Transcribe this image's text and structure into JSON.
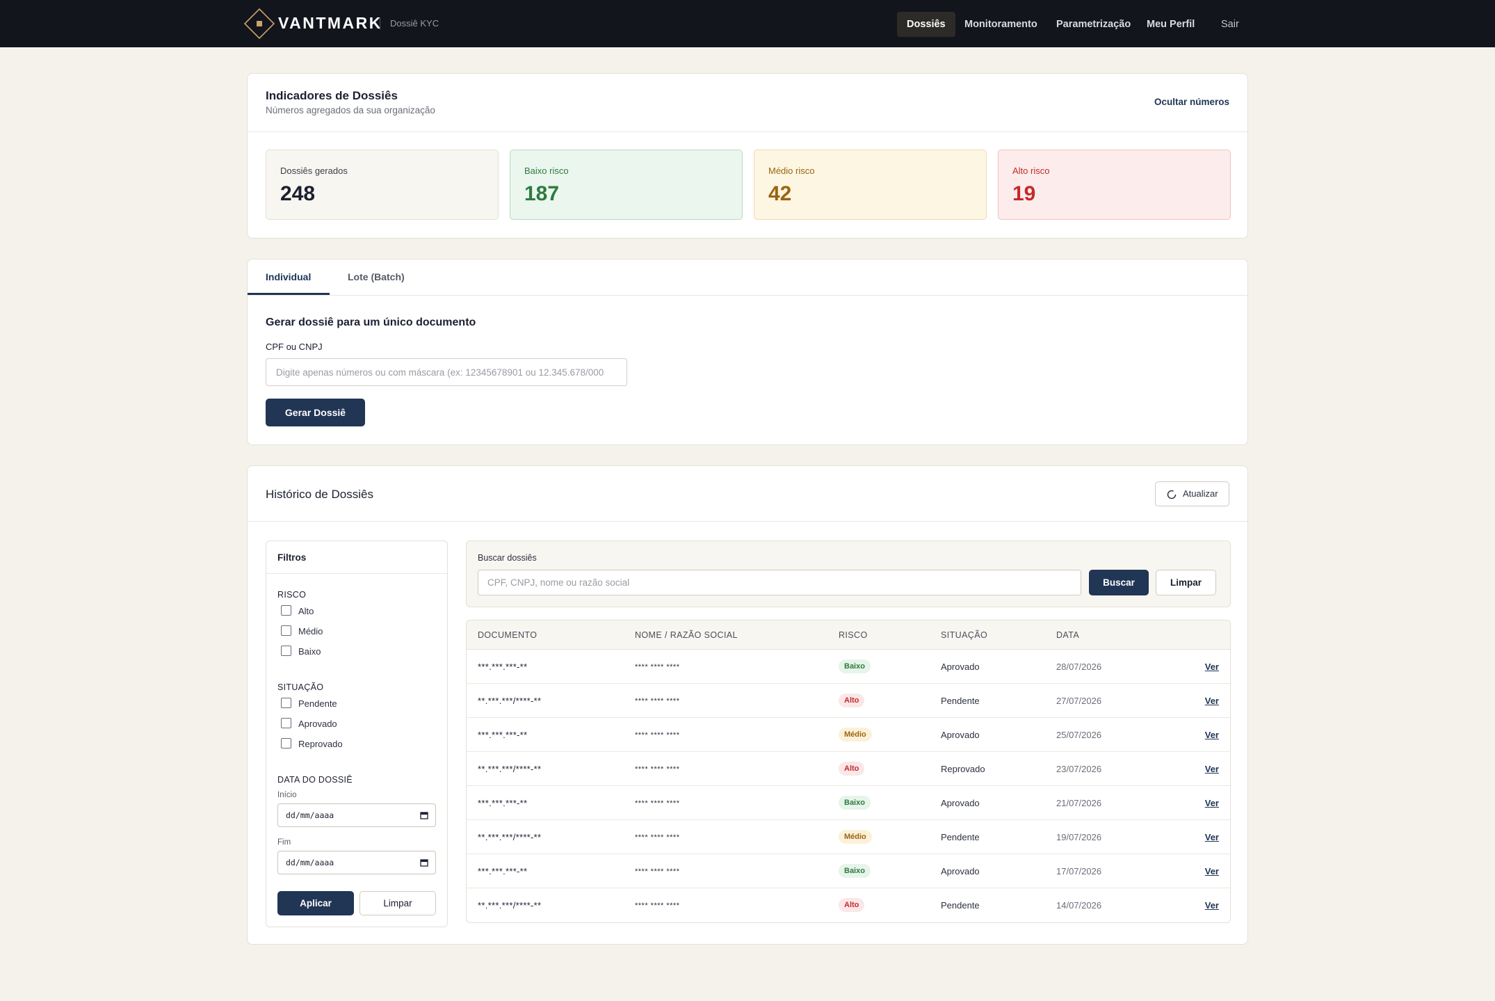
{
  "nav": {
    "brand": "VANTMARK",
    "subtitle": "Dossiê KYC",
    "items": [
      "Dossiês",
      "Monitoramento",
      "Parametrização",
      "Meu Perfil"
    ],
    "logout": "Sair"
  },
  "indicators": {
    "title": "Indicadores de Dossiês",
    "subtitle": "Números agregados da sua organização",
    "hide_label": "Ocultar números",
    "stats": [
      {
        "label": "Dossiês gerados",
        "value": "248",
        "color": "#1c2030"
      },
      {
        "label": "Baixo risco",
        "value": "187",
        "color": "#2f7a3f"
      },
      {
        "label": "Médio risco",
        "value": "42",
        "color": "#9a6510"
      },
      {
        "label": "Alto risco",
        "value": "19",
        "color": "#c42a2a"
      }
    ]
  },
  "generate": {
    "tabs": [
      "Individual",
      "Lote (Batch)"
    ],
    "title": "Gerar dossiê para um único documento",
    "field_label": "CPF ou CNPJ",
    "placeholder": "Digite apenas números ou com máscara (ex: 12345678901 ou 12.345.678/000",
    "button": "Gerar Dossiê"
  },
  "history": {
    "title": "Histórico de Dossiês",
    "refresh": "Atualizar",
    "filters": {
      "title": "Filtros",
      "risk_title": "RISCO",
      "risk_options": [
        "Alto",
        "Médio",
        "Baixo"
      ],
      "status_title": "SITUAÇÃO",
      "status_options": [
        "Pendente",
        "Aprovado",
        "Reprovado"
      ],
      "date_title": "DATA DO DOSSIÊ",
      "start_label": "Início",
      "end_label": "Fim",
      "date_placeholder": "dd/mm/aaaa",
      "apply": "Aplicar",
      "clear": "Limpar"
    },
    "search": {
      "label": "Buscar dossiês",
      "placeholder": "CPF, CNPJ, nome ou razão social",
      "button": "Buscar",
      "clear": "Limpar"
    },
    "table": {
      "columns": [
        "DOCUMENTO",
        "NOME / RAZÃO SOCIAL",
        "RISCO",
        "SITUAÇÃO",
        "DATA"
      ],
      "action_label": "Ver",
      "rows": [
        {
          "doc": "***.***.***-**",
          "name": "**** **** ****",
          "risk": "Baixo",
          "status": "Aprovado",
          "date": "28/07/2026"
        },
        {
          "doc": "**.***.***/****-**",
          "name": "**** **** ****",
          "risk": "Alto",
          "status": "Pendente",
          "date": "27/07/2026"
        },
        {
          "doc": "***.***.***-**",
          "name": "**** **** ****",
          "risk": "Médio",
          "status": "Aprovado",
          "date": "25/07/2026"
        },
        {
          "doc": "**.***.***/****-**",
          "name": "**** **** ****",
          "risk": "Alto",
          "status": "Reprovado",
          "date": "23/07/2026"
        },
        {
          "doc": "***.***.***-**",
          "name": "**** **** ****",
          "risk": "Baixo",
          "status": "Aprovado",
          "date": "21/07/2026"
        },
        {
          "doc": "**.***.***/****-**",
          "name": "**** **** ****",
          "risk": "Médio",
          "status": "Pendente",
          "date": "19/07/2026"
        },
        {
          "doc": "***.***.***-**",
          "name": "**** **** ****",
          "risk": "Baixo",
          "status": "Aprovado",
          "date": "17/07/2026"
        },
        {
          "doc": "**.***.***/****-**",
          "name": "**** **** ****",
          "risk": "Alto",
          "status": "Pendente",
          "date": "14/07/2026"
        }
      ]
    }
  },
  "colors": {
    "nav_bg": "#13151d",
    "primary": "#213555",
    "page_bg": "#f5f2ec",
    "logo_accent": "#c9a46a"
  },
  "icons": [
    "diamond-logo-icon",
    "refresh-icon",
    "calendar-icon"
  ]
}
